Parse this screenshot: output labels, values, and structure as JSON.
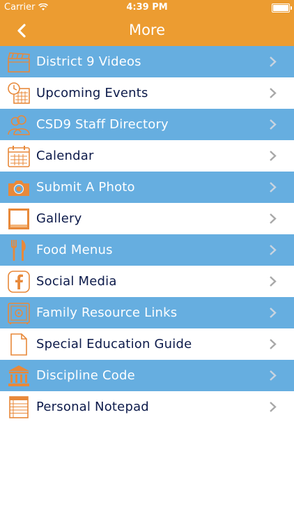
{
  "status_bar": {
    "carrier": "Carrier",
    "time": "4:39 PM",
    "battery_level": 1.0
  },
  "nav": {
    "title": "More",
    "back_icon": "chevron-left-icon"
  },
  "colors": {
    "accent": "#ec9c31",
    "row_blue": "#66aee0",
    "icon_orange": "#e8893a",
    "text_dark": "#0c1a4a"
  },
  "menu": [
    {
      "label": "District 9 Videos",
      "icon": "clapperboard-icon"
    },
    {
      "label": "Upcoming Events",
      "icon": "calendar-clock-icon"
    },
    {
      "label": "CSD9 Staff Directory",
      "icon": "people-icon"
    },
    {
      "label": "Calendar",
      "icon": "calendar-icon"
    },
    {
      "label": "Submit A Photo",
      "icon": "camera-icon"
    },
    {
      "label": "Gallery",
      "icon": "picture-frame-icon"
    },
    {
      "label": "Food Menus",
      "icon": "fork-knife-icon"
    },
    {
      "label": "Social Media",
      "icon": "facebook-icon"
    },
    {
      "label": "Family Resource Links",
      "icon": "safe-icon"
    },
    {
      "label": "Special Education Guide",
      "icon": "document-icon"
    },
    {
      "label": "Discipline Code",
      "icon": "courthouse-icon"
    },
    {
      "label": "Personal Notepad",
      "icon": "notepad-icon"
    }
  ]
}
